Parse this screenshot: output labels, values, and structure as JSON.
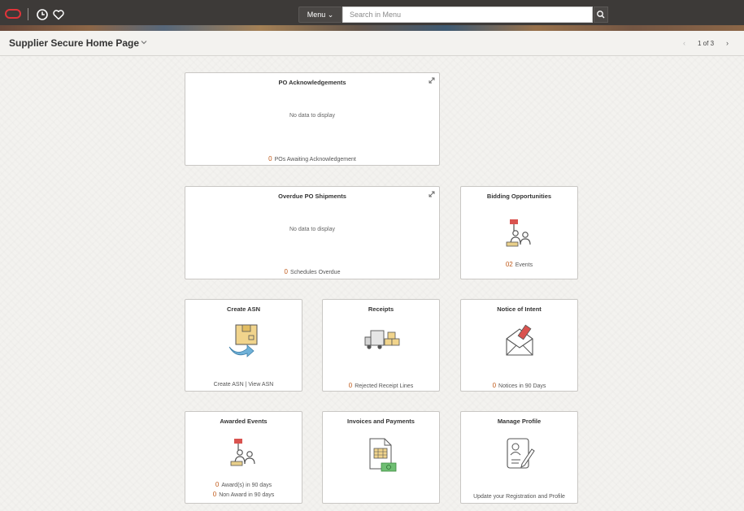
{
  "header": {
    "menu_label": "Menu ⌄",
    "search_placeholder": "Search in Menu"
  },
  "titlebar": {
    "title": "Supplier Secure Home Page",
    "pager": "1 of 3"
  },
  "tiles": {
    "po_ack": {
      "title": "PO Acknowledgements",
      "message": "No data to display",
      "count": "0",
      "count_label": "POs Awaiting Acknowledgement"
    },
    "overdue": {
      "title": "Overdue PO Shipments",
      "message": "No data to display",
      "count": "0",
      "count_label": "Schedules Overdue"
    },
    "bidding": {
      "title": "Bidding Opportunities",
      "count": "02",
      "count_label": "Events"
    },
    "create_asn": {
      "title": "Create ASN",
      "footer": "Create ASN | View ASN"
    },
    "receipts": {
      "title": "Receipts",
      "count": "0",
      "count_label": "Rejected Receipt Lines"
    },
    "notice": {
      "title": "Notice of Intent",
      "count": "0",
      "count_label": "Notices in 90 Days"
    },
    "awarded": {
      "title": "Awarded Events",
      "count1": "0",
      "count1_label": "Award(s) in 90 days",
      "count2": "0",
      "count2_label": "Non Award in 90 days"
    },
    "invoices": {
      "title": "Invoices and Payments"
    },
    "profile": {
      "title": "Manage Profile",
      "footer": "Update your Registration and Profile"
    }
  },
  "colors": {
    "accent": "#c05a1a",
    "banner": "#3d3a38",
    "logo": "#e0343a"
  },
  "icons": [
    "oracle-logo",
    "recent-history-icon",
    "favorites-icon",
    "search-icon",
    "chevron-down-icon",
    "expand-icon",
    "bidding-icon",
    "asn-box-icon",
    "truck-icon",
    "envelope-icon",
    "invoice-icon",
    "profile-icon"
  ]
}
